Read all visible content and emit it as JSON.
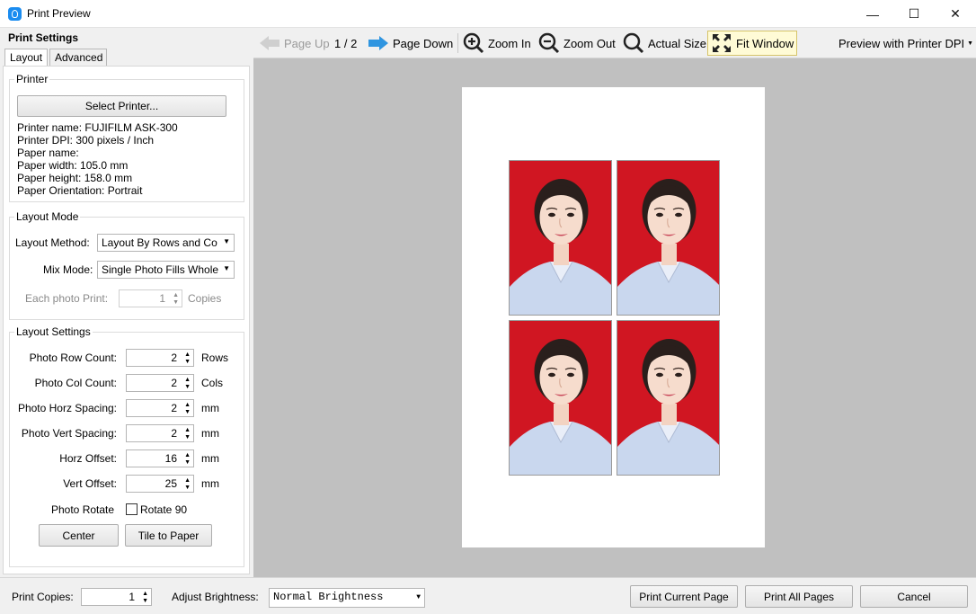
{
  "window": {
    "title": "Print Preview",
    "minimize_glyph": "—",
    "maximize_glyph": "☐",
    "close_glyph": "✕"
  },
  "left": {
    "header": "Print Settings",
    "tabs": [
      "Layout",
      "Advanced"
    ],
    "printer": {
      "group_title": "Printer",
      "select_button": "Select Printer...",
      "info_lines": [
        "Printer name: FUJIFILM ASK-300",
        "Printer DPI: 300 pixels / Inch",
        "Paper name:",
        "Paper width: 105.0 mm",
        "Paper height: 158.0 mm",
        "Paper Orientation: Portrait"
      ]
    },
    "layout_mode": {
      "group_title": "Layout Mode",
      "method_label": "Layout Method:",
      "method_value": "Layout By Rows and Co",
      "mix_label": "Mix Mode:",
      "mix_value": "Single Photo Fills Whole",
      "each_label": "Each photo Print:",
      "each_value": "1",
      "each_unit": "Copies"
    },
    "layout_settings": {
      "group_title": "Layout Settings",
      "rows": [
        {
          "label": "Photo Row Count:",
          "value": "2",
          "unit": "Rows"
        },
        {
          "label": "Photo Col Count:",
          "value": "2",
          "unit": "Cols"
        },
        {
          "label": "Photo Horz Spacing:",
          "value": "2",
          "unit": "mm"
        },
        {
          "label": "Photo Vert Spacing:",
          "value": "2",
          "unit": "mm"
        },
        {
          "label": "Horz Offset:",
          "value": "16",
          "unit": "mm"
        },
        {
          "label": "Vert Offset:",
          "value": "25",
          "unit": "mm"
        }
      ],
      "rotate_label": "Photo Rotate",
      "rotate_check_label": "Rotate 90",
      "rotate_checked": false,
      "center_button": "Center",
      "tile_button": "Tile to Paper"
    }
  },
  "toolbar": {
    "page_up": "Page Up",
    "page_indicator": "1 / 2",
    "page_down": "Page Down",
    "zoom_in": "Zoom In",
    "zoom_out": "Zoom Out",
    "actual_size": "Actual Size",
    "fit_window": "Fit Window",
    "preview_dpi": "Preview with Printer DPI"
  },
  "preview": {
    "photo_count": 4,
    "photo_background": "#d01622"
  },
  "bottom": {
    "copies_label": "Print Copies:",
    "copies_value": "1",
    "brightness_label": "Adjust Brightness:",
    "brightness_value": "Normal Brightness",
    "print_current": "Print Current Page",
    "print_all": "Print All Pages",
    "cancel": "Cancel"
  },
  "colors": {
    "accent_blue": "#1a8cf0",
    "fit_window_highlight": "#fffbd6",
    "preview_bg": "#c0c0c0"
  }
}
